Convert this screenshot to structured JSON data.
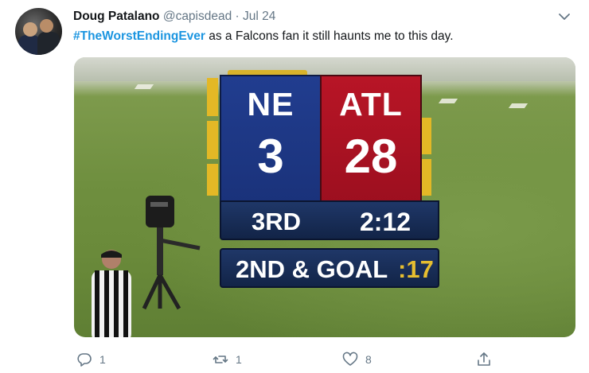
{
  "tweet": {
    "author_name": "Doug Patalano",
    "handle": "@capisdead",
    "separator": "·",
    "date": "Jul 24",
    "hashtag": "#TheWorstEndingEver",
    "body": " as a Falcons fan it still haunts me to this day."
  },
  "scoreboard": {
    "home_team": "NE",
    "home_score": "3",
    "away_team": "ATL",
    "away_score": "28",
    "quarter": "3RD",
    "clock": "2:12",
    "down_distance": "2ND & GOAL",
    "play_clock": ":17"
  },
  "actions": {
    "reply_count": "1",
    "retweet_count": "1",
    "like_count": "8",
    "share_count": ""
  },
  "colors": {
    "hashtag": "#1b95e0",
    "meta_gray": "#657786",
    "ne_blue": "#213d8f",
    "atl_red": "#b81526",
    "accent_gold": "#e3b826"
  },
  "icons": [
    "reply-icon",
    "retweet-icon",
    "like-icon",
    "share-icon",
    "chevron-down-icon"
  ]
}
